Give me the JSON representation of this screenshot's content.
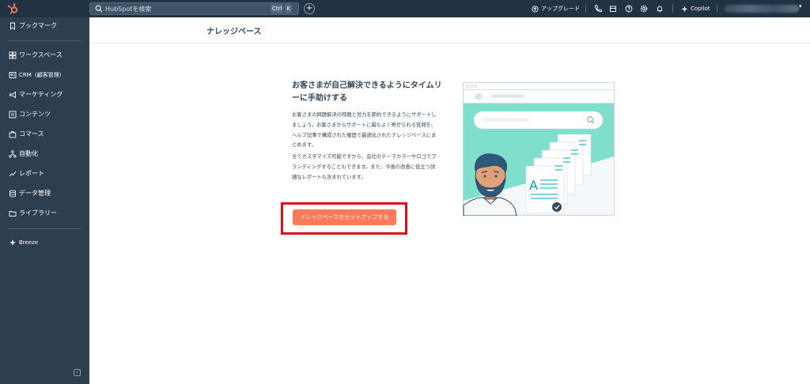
{
  "topbar": {
    "search_placeholder": "HubSpotを検索",
    "shortcut_key1": "Ctrl",
    "shortcut_key2": "K",
    "upgrade_label": "アップグレード",
    "copilot_label": "Copilot"
  },
  "sidebar": {
    "items": [
      {
        "label": "ブックマーク",
        "icon": "bookmark-icon"
      },
      {
        "label": "ワークスペース",
        "icon": "workspace-icon"
      },
      {
        "label": "CRM（顧客管理）",
        "icon": "crm-icon"
      },
      {
        "label": "マーケティング",
        "icon": "marketing-icon"
      },
      {
        "label": "コンテンツ",
        "icon": "content-icon"
      },
      {
        "label": "コマース",
        "icon": "commerce-icon"
      },
      {
        "label": "自動化",
        "icon": "automation-icon"
      },
      {
        "label": "レポート",
        "icon": "reports-icon"
      },
      {
        "label": "データ管理",
        "icon": "data-management-icon"
      },
      {
        "label": "ライブラリー",
        "icon": "library-icon"
      },
      {
        "label": "Breeze",
        "icon": "breeze-icon"
      }
    ]
  },
  "header": {
    "title": "ナレッジベース"
  },
  "main": {
    "heading": "お客さまが自己解決できるようにタイムリーに手助けする",
    "paragraph1": "お客さまの問題解決の時間と労力を節約できるようにサポートしましょう。お客さまからサポートに最もよく寄せられる質問を、ヘルプ記事で構成された履歴で最適化されたナレッジベースにまとめます。",
    "paragraph2": "全てカスタマイズ可能ですから、会社のテーマカラーやロゴでブランディングすることもできます。また、今後の改善に役立つ詳細なレポートも含まれています。",
    "cta_label": "ナレッジベースをセットアップする"
  },
  "colors": {
    "nav_bg": "#2d3e50",
    "topbar_bg": "#213343",
    "accent": "#ff7a59",
    "highlight": "#e00c17",
    "teal": "#7fdfcc"
  }
}
